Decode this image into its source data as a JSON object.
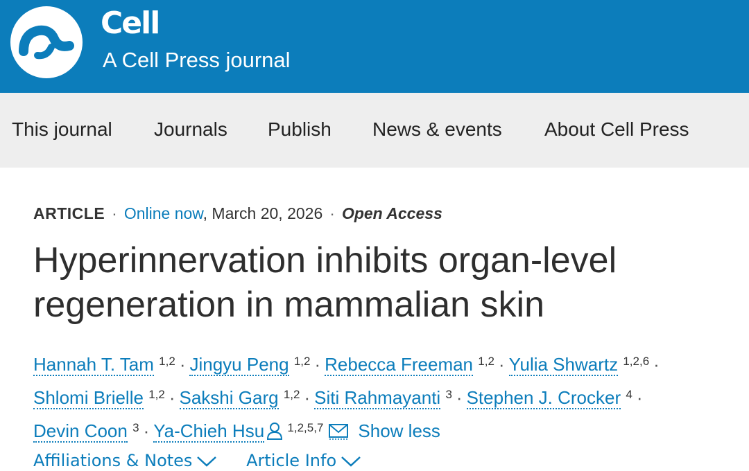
{
  "header": {
    "brand_name": "Cell",
    "tagline": "A Cell Press journal",
    "logo_icon": "cell-press-logo",
    "background_color": "#0c7dbb"
  },
  "nav": {
    "items": [
      "This journal",
      "Journals",
      "Publish",
      "News & events",
      "About Cell Press"
    ]
  },
  "article": {
    "type": "ARTICLE",
    "separator": "·",
    "status": "Online now",
    "date": ", March 20, 2026",
    "access": "Open Access",
    "title": "Hyperinnervation inhibits organ-level regeneration in mammalian skin",
    "authors": [
      {
        "name": "Hannah T. Tam",
        "affiliations": "1,2"
      },
      {
        "name": "Jingyu Peng",
        "affiliations": "1,2"
      },
      {
        "name": "Rebecca Freeman",
        "affiliations": "1,2"
      },
      {
        "name": "Yulia Shwartz",
        "affiliations": "1,2,6"
      },
      {
        "name": "Shlomi Brielle",
        "affiliations": "1,2"
      },
      {
        "name": "Sakshi Garg",
        "affiliations": "1,2"
      },
      {
        "name": "Siti Rahmayanti",
        "affiliations": "3"
      },
      {
        "name": "Stephen J. Crocker",
        "affiliations": "4"
      },
      {
        "name": "Devin Coon",
        "affiliations": "3"
      },
      {
        "name": "Ya-Chieh Hsu",
        "affiliations": "1,2,5,7"
      }
    ],
    "show_less": "Show less",
    "affiliations_toggle": "Affiliations & Notes",
    "info_toggle": "Article Info"
  },
  "colors": {
    "link": "#0c7dbb",
    "nav_background": "#eeeeee",
    "text": "#333333"
  }
}
